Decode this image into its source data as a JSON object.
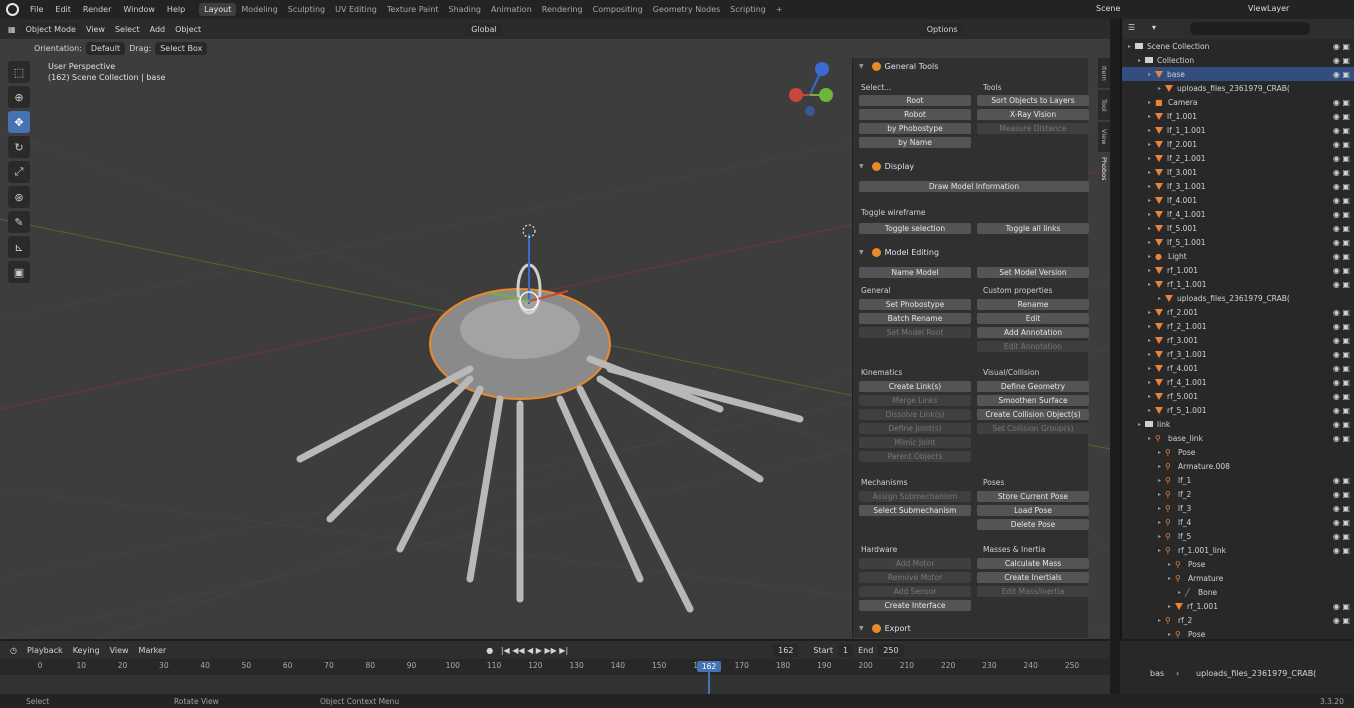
{
  "topbar": {
    "menus": [
      "File",
      "Edit",
      "Render",
      "Window",
      "Help"
    ],
    "workspaces": [
      "Layout",
      "Modeling",
      "Sculpting",
      "UV Editing",
      "Texture Paint",
      "Shading",
      "Animation",
      "Rendering",
      "Compositing",
      "Geometry Nodes",
      "Scripting",
      "+"
    ],
    "active_workspace": "Layout",
    "scene": "Scene",
    "view_layer": "ViewLayer"
  },
  "viewport": {
    "mode": "Object Mode",
    "menus": [
      "View",
      "Select",
      "Add",
      "Object"
    ],
    "orientation_label": "Orientation:",
    "orientation_value": "Default",
    "drag_label": "Drag:",
    "drag_value": "Select Box",
    "transform_orientation": "Global",
    "options": "Options",
    "info_line1": "User Perspective",
    "info_line2": "(162) Scene Collection | base"
  },
  "panel": {
    "tabs": [
      "Item",
      "Tool",
      "View",
      "Phobos"
    ],
    "general_tools": "General Tools",
    "select_label": "Select...",
    "tools_label": "Tools",
    "select_buttons": [
      "Root",
      "Robot",
      "by Phobostype",
      "by Name"
    ],
    "tools_buttons": [
      "Sort Objects to Layers",
      "X-Ray Vision",
      "Measure Distance"
    ],
    "display": "Display",
    "draw_model_info": "Draw Model Information",
    "toggle_wireframe": "Toggle wireframe",
    "toggle_selection": "Toggle selection",
    "toggle_all_links": "Toggle all links",
    "model_editing": "Model Editing",
    "name_model": "Name Model",
    "set_model_version": "Set Model Version",
    "general": "General",
    "custom_properties": "Custom properties",
    "general_buttons": [
      "Set Phobostype",
      "Batch Rename",
      "Set Model Root"
    ],
    "custom_buttons": [
      "Rename",
      "Edit",
      "Add Annotation",
      "Edit Annotation"
    ],
    "kinematics": "Kinematics",
    "visual_collision": "Visual/Collision",
    "kin_buttons": [
      "Create Link(s)",
      "Merge Links",
      "Dissolve Link(s)",
      "Define Joint(s)",
      "Mimic Joint",
      "Parent Objects"
    ],
    "vis_buttons": [
      "Define Geometry",
      "Smoothen Surface",
      "Create Collision Object(s)",
      "Set Collision Group(s)"
    ],
    "mechanisms": "Mechanisms",
    "poses": "Poses",
    "mech_buttons": [
      "Assign Submechanism",
      "Select Submechanism"
    ],
    "pose_buttons": [
      "Store Current Pose",
      "Load Pose",
      "Delete Pose"
    ],
    "hardware": "Hardware",
    "masses_inertia": "Masses & Inertia",
    "hw_buttons": [
      "Add Motor",
      "Remove Motor",
      "Add Sensor",
      "Create Interface"
    ],
    "mass_buttons": [
      "Calculate Mass",
      "Create Inertials",
      "Edit Mass/Inertia"
    ],
    "export": "Export"
  },
  "outliner": {
    "rows": [
      {
        "label": "Scene Collection",
        "kind": "col",
        "indent": 0
      },
      {
        "label": "Collection",
        "kind": "col",
        "indent": 1
      },
      {
        "label": "base",
        "kind": "mesh",
        "indent": 2,
        "sel": true
      },
      {
        "label": "uploads_files_2361979_CRAB(",
        "kind": "data",
        "indent": 3
      },
      {
        "label": "Camera",
        "kind": "cam",
        "indent": 2
      },
      {
        "label": "lf_1.001",
        "kind": "mesh",
        "indent": 2
      },
      {
        "label": "lf_1_1.001",
        "kind": "mesh",
        "indent": 2
      },
      {
        "label": "lf_2.001",
        "kind": "mesh",
        "indent": 2
      },
      {
        "label": "lf_2_1.001",
        "kind": "mesh",
        "indent": 2
      },
      {
        "label": "lf_3.001",
        "kind": "mesh",
        "indent": 2
      },
      {
        "label": "lf_3_1.001",
        "kind": "mesh",
        "indent": 2
      },
      {
        "label": "lf_4.001",
        "kind": "mesh",
        "indent": 2
      },
      {
        "label": "lf_4_1.001",
        "kind": "mesh",
        "indent": 2
      },
      {
        "label": "lf_5.001",
        "kind": "mesh",
        "indent": 2
      },
      {
        "label": "lf_5_1.001",
        "kind": "mesh",
        "indent": 2
      },
      {
        "label": "Light",
        "kind": "light",
        "indent": 2
      },
      {
        "label": "rf_1.001",
        "kind": "mesh",
        "indent": 2
      },
      {
        "label": "rf_1_1.001",
        "kind": "mesh",
        "indent": 2
      },
      {
        "label": "uploads_files_2361979_CRAB(",
        "kind": "data",
        "indent": 3
      },
      {
        "label": "rf_2.001",
        "kind": "mesh",
        "indent": 2
      },
      {
        "label": "rf_2_1.001",
        "kind": "mesh",
        "indent": 2
      },
      {
        "label": "rf_3.001",
        "kind": "mesh",
        "indent": 2
      },
      {
        "label": "rf_3_1.001",
        "kind": "mesh",
        "indent": 2
      },
      {
        "label": "rf_4.001",
        "kind": "mesh",
        "indent": 2
      },
      {
        "label": "rf_4_1.001",
        "kind": "mesh",
        "indent": 2
      },
      {
        "label": "rf_5.001",
        "kind": "mesh",
        "indent": 2
      },
      {
        "label": "rf_5_1.001",
        "kind": "mesh",
        "indent": 2
      },
      {
        "label": "link",
        "kind": "col",
        "indent": 1
      },
      {
        "label": "base_link",
        "kind": "arm",
        "indent": 2
      },
      {
        "label": "Pose",
        "kind": "pose",
        "indent": 3
      },
      {
        "label": "Armature.008",
        "kind": "pose",
        "indent": 3
      },
      {
        "label": "lf_1",
        "kind": "arm",
        "indent": 3
      },
      {
        "label": "lf_2",
        "kind": "arm",
        "indent": 3
      },
      {
        "label": "lf_3",
        "kind": "arm",
        "indent": 3
      },
      {
        "label": "lf_4",
        "kind": "arm",
        "indent": 3
      },
      {
        "label": "lf_5",
        "kind": "arm",
        "indent": 3
      },
      {
        "label": "rf_1.001_link",
        "kind": "arm",
        "indent": 3
      },
      {
        "label": "Pose",
        "kind": "pose",
        "indent": 4
      },
      {
        "label": "Armature",
        "kind": "pose",
        "indent": 4
      },
      {
        "label": "Bone",
        "kind": "bone",
        "indent": 5
      },
      {
        "label": "rf_1.001",
        "kind": "mesh",
        "indent": 4
      },
      {
        "label": "rf_2",
        "kind": "arm",
        "indent": 3
      },
      {
        "label": "Pose",
        "kind": "pose",
        "indent": 4
      }
    ]
  },
  "timeline": {
    "menus": [
      "Playback",
      "Keying",
      "View",
      "Marker"
    ],
    "current_frame": "162",
    "start_label": "Start",
    "start": "1",
    "end_label": "End",
    "end": "250",
    "ticks": [
      "0",
      "10",
      "20",
      "30",
      "40",
      "50",
      "60",
      "70",
      "80",
      "90",
      "100",
      "110",
      "120",
      "130",
      "140",
      "150",
      "160",
      "170",
      "180",
      "190",
      "200",
      "210",
      "220",
      "230",
      "240",
      "250"
    ]
  },
  "breadcrumb": {
    "obj": "bas",
    "data": "uploads_files_2361979_CRAB("
  },
  "status": {
    "select": "Select",
    "rotate": "Rotate View",
    "context": "Object Context Menu",
    "version": "3.3.20"
  }
}
